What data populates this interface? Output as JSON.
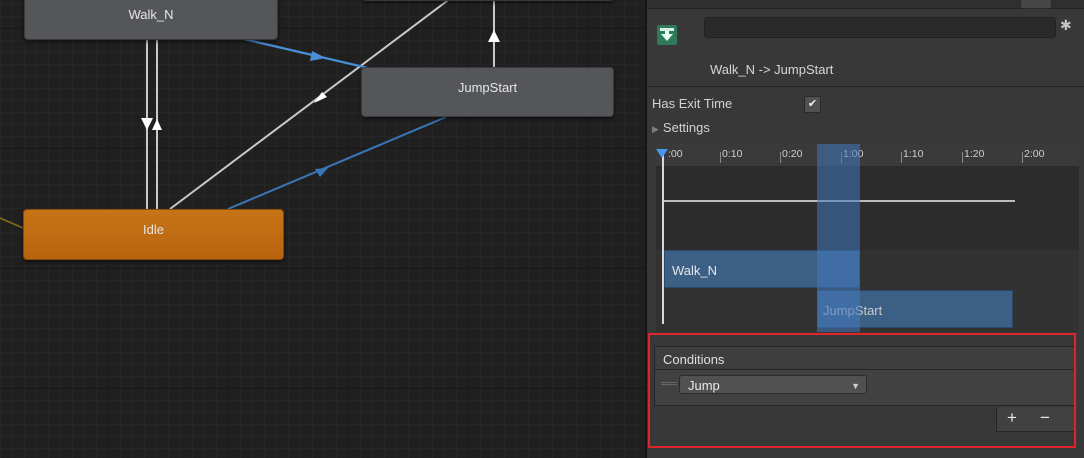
{
  "graph": {
    "states": {
      "walk": "Walk_N",
      "jump_start": "JumpStart",
      "idle": "Idle"
    },
    "colors": {
      "default_state": "#545659",
      "entry_state": "#c26d14",
      "selected_link": "#4a8fd6"
    }
  },
  "inspector": {
    "transition_title": "Walk_N -> JumpStart",
    "name_field_value": "",
    "has_exit_time_label": "Has Exit Time",
    "has_exit_time_checked": "✔",
    "settings_label": "Settings",
    "timeline": {
      "ticks": [
        ":00",
        "0:10",
        "0:20",
        "1:00",
        "1:10",
        "1:20",
        "2:00"
      ],
      "tracks": {
        "source": "Walk_N",
        "destination": "JumpStart"
      }
    },
    "conditions": {
      "header": "Conditions",
      "items": [
        {
          "parameter": "Jump"
        }
      ],
      "add_label": "+",
      "remove_label": "−"
    }
  }
}
